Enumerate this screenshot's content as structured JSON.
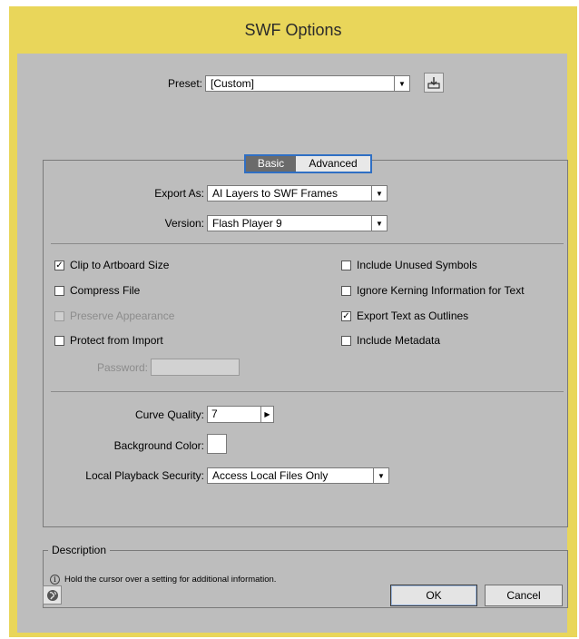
{
  "title": "SWF Options",
  "preset": {
    "label": "Preset:",
    "value": "[Custom]",
    "save_icon": "save-preset-icon"
  },
  "tabs": [
    {
      "label": "Basic",
      "active": true
    },
    {
      "label": "Advanced",
      "active": false
    }
  ],
  "export_as": {
    "label": "Export As:",
    "value": "AI Layers to SWF Frames"
  },
  "version": {
    "label": "Version:",
    "value": "Flash Player 9"
  },
  "options_left": [
    {
      "label": "Clip to Artboard Size",
      "checked": true,
      "disabled": false
    },
    {
      "label": "Compress File",
      "checked": false,
      "disabled": false
    },
    {
      "label": "Preserve Appearance",
      "checked": false,
      "disabled": true
    },
    {
      "label": "Protect from Import",
      "checked": false,
      "disabled": false
    }
  ],
  "options_right": [
    {
      "label": "Include Unused Symbols",
      "checked": false
    },
    {
      "label": "Ignore Kerning Information for Text",
      "checked": false
    },
    {
      "label": "Export Text as Outlines",
      "checked": true
    },
    {
      "label": "Include Metadata",
      "checked": false
    }
  ],
  "password": {
    "label": "Password:",
    "value": ""
  },
  "curve_quality": {
    "label": "Curve Quality:",
    "value": "7"
  },
  "background_color": {
    "label": "Background Color:",
    "color": "#ffffff"
  },
  "local_playback": {
    "label": "Local Playback Security:",
    "value": "Access Local Files Only"
  },
  "description": {
    "label": "Description",
    "text": "Hold the cursor over a setting for additional information.",
    "icon": "info-icon"
  },
  "buttons": {
    "ok": "OK",
    "cancel": "Cancel",
    "web_icon": "globe-icon"
  },
  "colors": {
    "title_bar": "#e9d65a",
    "dialog_bg": "#bdbdbd",
    "tab_accent": "#2f6fc4"
  }
}
